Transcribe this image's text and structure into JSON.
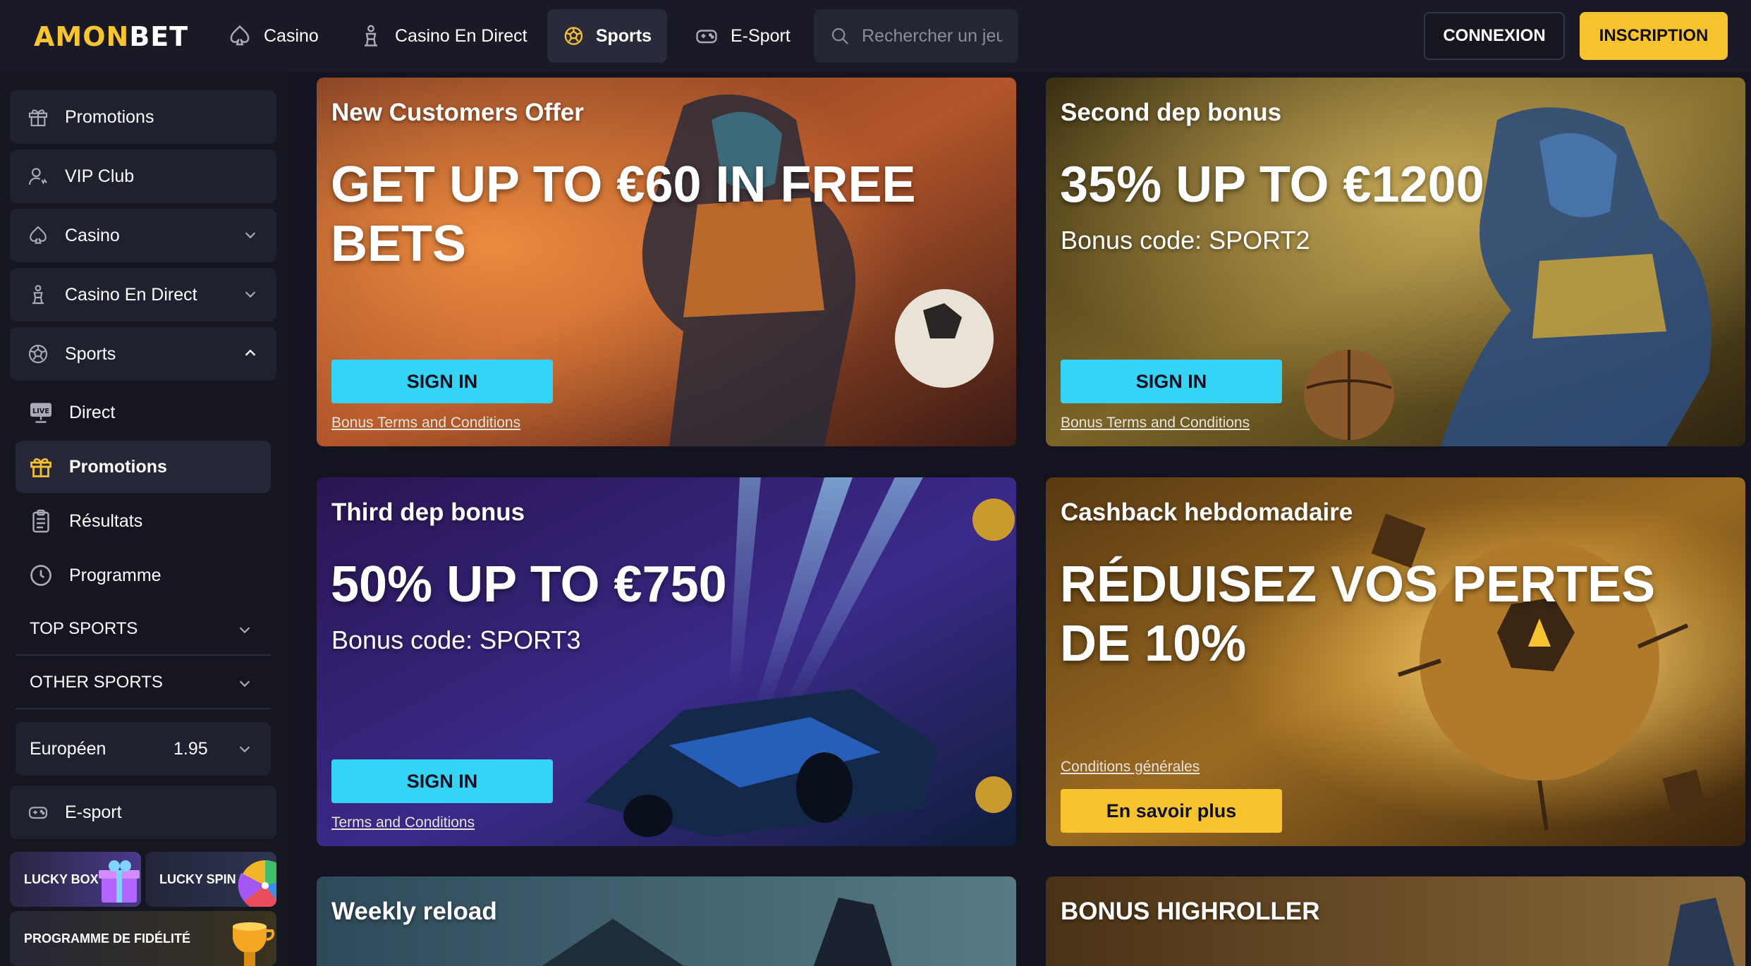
{
  "header": {
    "logo_gold": "AMON",
    "logo_white": "BET",
    "nav": [
      {
        "label": "Casino"
      },
      {
        "label": "Casino En Direct"
      },
      {
        "label": "Sports"
      },
      {
        "label": "E-Sport"
      }
    ],
    "search_placeholder": "Rechercher un jeu",
    "login_label": "CONNEXION",
    "signup_label": "INSCRIPTION"
  },
  "sidebar": {
    "items": [
      {
        "label": "Promotions"
      },
      {
        "label": "VIP Club"
      },
      {
        "label": "Casino"
      },
      {
        "label": "Casino En Direct"
      },
      {
        "label": "Sports"
      }
    ],
    "sports_sub": [
      {
        "label": "Direct"
      },
      {
        "label": "Promotions"
      },
      {
        "label": "Résultats"
      },
      {
        "label": "Programme"
      }
    ],
    "sections": [
      {
        "label": "TOP SPORTS"
      },
      {
        "label": "OTHER SPORTS"
      }
    ],
    "odds_format": {
      "label": "Européen",
      "value": "1.95"
    },
    "esport_label": "E-sport",
    "tiles": {
      "lucky_box": "LUCKY BOX",
      "lucky_spin": "LUCKY SPIN",
      "loyalty": "PROGRAMME DE FIDÉLITÉ"
    }
  },
  "cards": [
    {
      "title": "New Customers Offer",
      "headline": "GET UP TO €60 IN FREE BETS",
      "cta": "SIGN IN",
      "terms": "Bonus Terms and Conditions"
    },
    {
      "title": "Second dep bonus",
      "headline": "35% UP TO €1200",
      "code": "Bonus code: SPORT2",
      "cta": "SIGN IN",
      "terms": "Bonus Terms and Conditions"
    },
    {
      "title": "Third dep bonus",
      "headline": "50% UP TO €750",
      "code": "Bonus code: SPORT3",
      "cta": "SIGN IN",
      "terms": "Terms and Conditions"
    },
    {
      "title": "Cashback hebdomadaire",
      "headline": "RÉDUISEZ VOS PERTES DE 10%",
      "terms": "Conditions générales",
      "cta": "En savoir plus"
    },
    {
      "title": "Weekly reload"
    },
    {
      "title": "BONUS HIGHROLLER"
    }
  ],
  "colors": {
    "accent_gold": "#f9c330",
    "accent_cyan": "#35d3f5",
    "background": "#13141f"
  }
}
